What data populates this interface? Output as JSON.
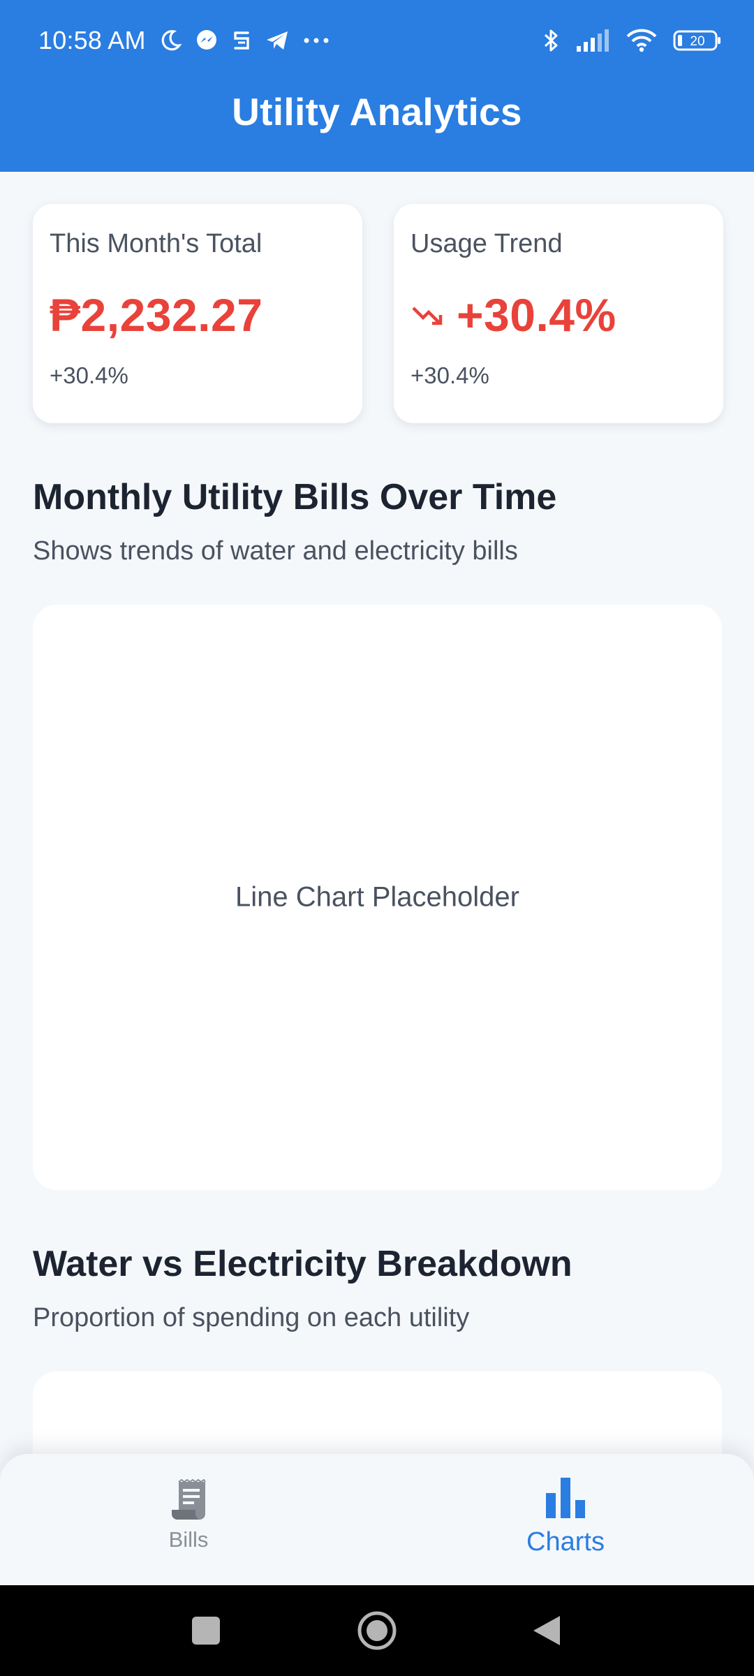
{
  "status_bar": {
    "time": "10:58 AM",
    "left_icons": [
      "moon-icon",
      "messenger-icon",
      "sim-icon",
      "telegram-icon",
      "more-dots-icon"
    ],
    "right_icons": [
      "bluetooth-icon",
      "signal-icon",
      "wifi-icon",
      "battery-icon"
    ],
    "battery_level": "20"
  },
  "app": {
    "title": "Utility Analytics",
    "accent_color": "#2a7de1",
    "negative_color": "#e8423a"
  },
  "cards": {
    "total": {
      "label": "This Month's Total",
      "value": "₱2,232.27",
      "change": "+30.4%"
    },
    "trend": {
      "label": "Usage Trend",
      "icon": "trending-down-icon",
      "value": "+30.4%",
      "change": "+30.4%"
    }
  },
  "sections": {
    "bills_over_time": {
      "title": "Monthly Utility Bills Over Time",
      "subtitle": "Shows trends of water and electricity bills",
      "placeholder": "Line Chart Placeholder"
    },
    "breakdown": {
      "title": "Water vs Electricity Breakdown",
      "subtitle": "Proportion of spending on each utility"
    }
  },
  "bottom_nav": {
    "items": [
      {
        "label": "Bills",
        "icon": "receipt-icon",
        "active": false
      },
      {
        "label": "Charts",
        "icon": "bar-chart-icon",
        "active": true
      }
    ]
  },
  "system_nav": {
    "buttons": [
      "recents-square-icon",
      "home-circle-icon",
      "back-triangle-icon"
    ]
  }
}
